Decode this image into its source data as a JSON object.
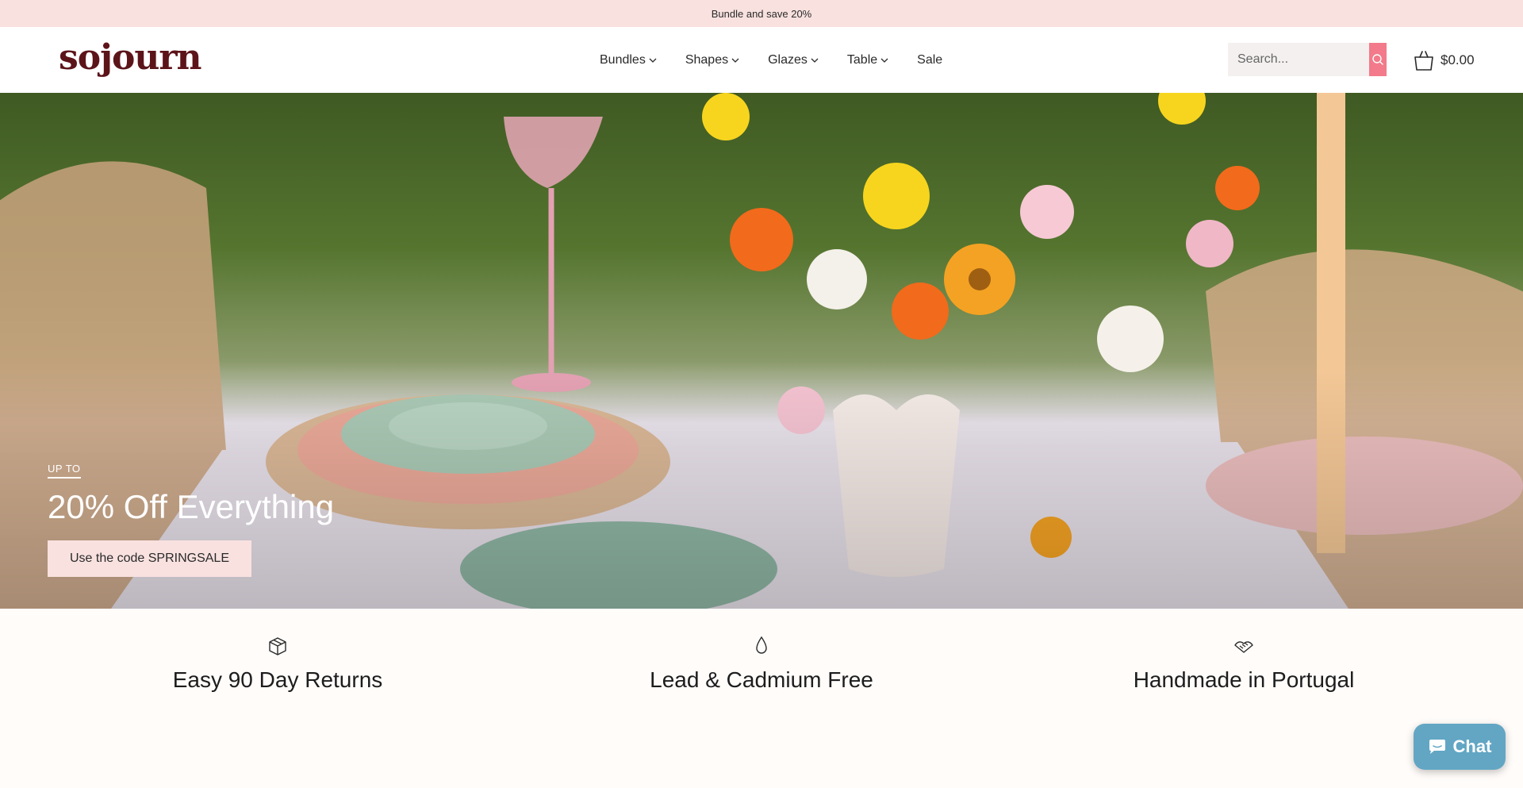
{
  "announcement": {
    "text": "Bundle and save 20%"
  },
  "header": {
    "logo": "sojourn",
    "nav": [
      {
        "label": "Bundles",
        "has_dropdown": true
      },
      {
        "label": "Shapes",
        "has_dropdown": true
      },
      {
        "label": "Glazes",
        "has_dropdown": true
      },
      {
        "label": "Table",
        "has_dropdown": true
      },
      {
        "label": "Sale",
        "has_dropdown": false
      }
    ],
    "search": {
      "placeholder": "Search...",
      "icon": "search-icon"
    },
    "cart": {
      "amount": "$0.00",
      "icon": "shopping-bag-icon"
    }
  },
  "hero": {
    "eyebrow": "UP TO",
    "headline": "20% Off Everything",
    "cta": "Use the code SPRINGSALE"
  },
  "features": [
    {
      "icon": "box-icon",
      "title": "Easy 90 Day Returns"
    },
    {
      "icon": "droplet-icon",
      "title": "Lead & Cadmium Free"
    },
    {
      "icon": "handshake-icon",
      "title": "Handmade in Portugal"
    }
  ],
  "chat": {
    "label": "Chat",
    "icon": "chat-bubble-icon"
  },
  "colors": {
    "announcement_bg": "#f8e1df",
    "logo": "#5c1419",
    "search_button": "#f27a8a",
    "cta_bg": "#f8e1df",
    "chat_bg": "#62a6c4"
  }
}
